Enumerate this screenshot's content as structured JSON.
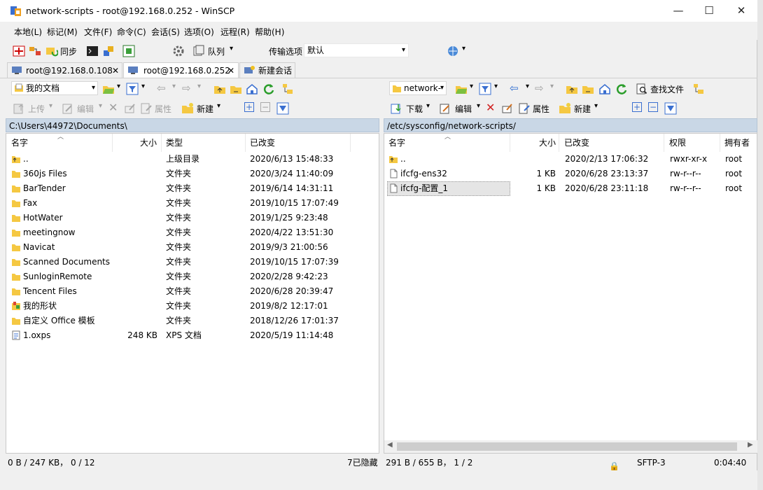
{
  "window": {
    "title": "network-scripts - root@192.168.0.252 - WinSCP"
  },
  "window_controls": {
    "minimize": "—",
    "maximize": "☐",
    "close": "✕"
  },
  "menu": [
    "本地(L)",
    "标记(M)",
    "文件(F)",
    "命令(C)",
    "会话(S)",
    "选项(O)",
    "远程(R)",
    "帮助(H)"
  ],
  "toolbar": {
    "sync": "同步",
    "queue": "队列",
    "transfer_options": "传输选项",
    "transfer_default": "默认"
  },
  "tabs": [
    {
      "label": "root@192.168.0.108",
      "close": "✕"
    },
    {
      "label": "root@192.168.0.252",
      "close": "✕"
    },
    {
      "label": "新建会话"
    }
  ],
  "left": {
    "location": "我的文档",
    "actions": {
      "upload": "上传",
      "edit": "编辑",
      "properties": "属性",
      "new": "新建"
    },
    "path": "C:\\Users\\44972\\Documents\\",
    "columns": [
      "名字",
      "大小",
      "类型",
      "已改变"
    ],
    "rows": [
      {
        "icon": "parent",
        "name": "..",
        "size": "",
        "type": "上级目录",
        "changed": "2020/6/13  15:48:33"
      },
      {
        "icon": "folder",
        "name": "360js Files",
        "size": "",
        "type": "文件夹",
        "changed": "2020/3/24  11:40:09"
      },
      {
        "icon": "folder",
        "name": "BarTender",
        "size": "",
        "type": "文件夹",
        "changed": "2019/6/14  14:31:11"
      },
      {
        "icon": "folder",
        "name": "Fax",
        "size": "",
        "type": "文件夹",
        "changed": "2019/10/15  17:07:49"
      },
      {
        "icon": "folder",
        "name": "HotWater",
        "size": "",
        "type": "文件夹",
        "changed": "2019/1/25  9:23:48"
      },
      {
        "icon": "folder",
        "name": "meetingnow",
        "size": "",
        "type": "文件夹",
        "changed": "2020/4/22  13:51:30"
      },
      {
        "icon": "folder",
        "name": "Navicat",
        "size": "",
        "type": "文件夹",
        "changed": "2019/9/3  21:00:56"
      },
      {
        "icon": "folder",
        "name": "Scanned Documents",
        "size": "",
        "type": "文件夹",
        "changed": "2019/10/15  17:07:39"
      },
      {
        "icon": "folder",
        "name": "SunloginRemote",
        "size": "",
        "type": "文件夹",
        "changed": "2020/2/28  9:42:23"
      },
      {
        "icon": "folder",
        "name": "Tencent Files",
        "size": "",
        "type": "文件夹",
        "changed": "2020/6/28  20:39:47"
      },
      {
        "icon": "shape",
        "name": "我的形状",
        "size": "",
        "type": "文件夹",
        "changed": "2019/8/2  12:17:01"
      },
      {
        "icon": "folder",
        "name": "自定义 Office 模板",
        "size": "",
        "type": "文件夹",
        "changed": "2018/12/26  17:01:37"
      },
      {
        "icon": "doc",
        "name": "1.oxps",
        "size": "248 KB",
        "type": "XPS 文档",
        "changed": "2020/5/19  11:14:48"
      }
    ],
    "status": "0 B / 247 KB，  0 / 12",
    "hidden": "7已隐藏"
  },
  "right": {
    "location": "network-",
    "actions": {
      "download": "下载",
      "edit": "编辑",
      "properties": "属性",
      "new": "新建",
      "find": "查找文件"
    },
    "path": "/etc/sysconfig/network-scripts/",
    "columns": [
      "名字",
      "大小",
      "已改变",
      "权限",
      "拥有者"
    ],
    "rows": [
      {
        "icon": "parent",
        "name": "..",
        "size": "",
        "changed": "2020/2/13 17:06:32",
        "rights": "rwxr-xr-x",
        "owner": "root"
      },
      {
        "icon": "file",
        "name": "ifcfg-ens32",
        "size": "1 KB",
        "changed": "2020/6/28 23:13:37",
        "rights": "rw-r--r--",
        "owner": "root"
      },
      {
        "icon": "file",
        "name": "ifcfg-配置_1",
        "size": "1 KB",
        "changed": "2020/6/28 23:11:18",
        "rights": "rw-r--r--",
        "owner": "root"
      }
    ],
    "status": "291 B / 655 B，  1 / 2",
    "protocol": "SFTP-3",
    "time": "0:04:40"
  },
  "colors": {
    "path_bar": "#c9d7e6",
    "selected_row": "#e5e5e5",
    "folder": "#f5c842"
  }
}
